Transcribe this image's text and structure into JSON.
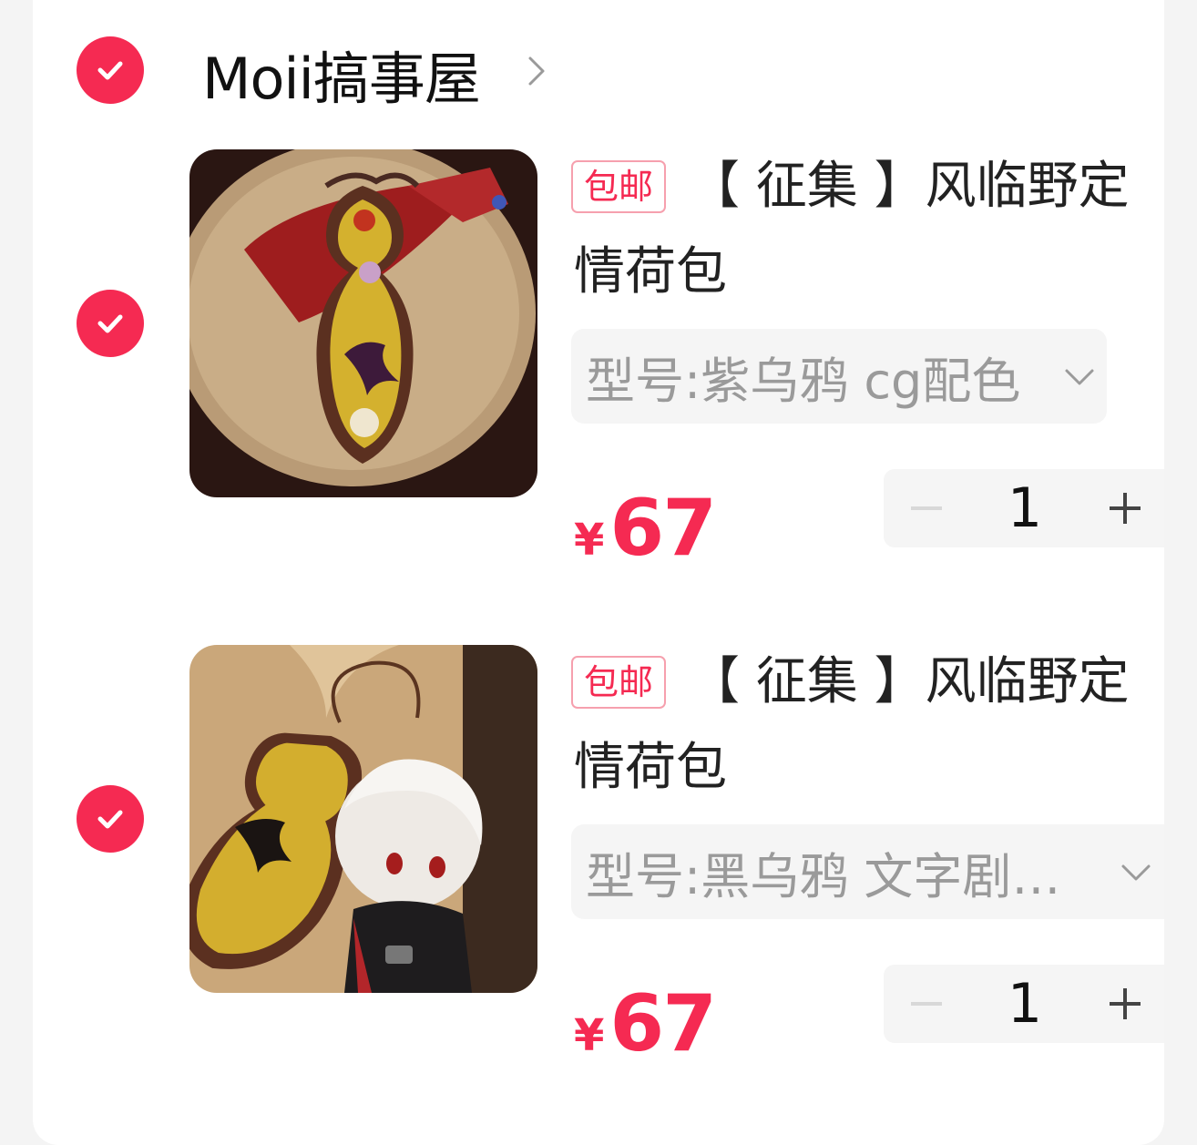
{
  "shop": {
    "name": "Moii搞事屋"
  },
  "colors": {
    "accent": "#f52a52",
    "tag_border": "#f6a0ae",
    "muted": "#9a9a9a"
  },
  "items": [
    {
      "tag": "包邮",
      "title": "【 征集 】风临野定情荷包",
      "variant": "型号:紫乌鸦  cg配色",
      "currency": "¥",
      "price": "67",
      "quantity": "1"
    },
    {
      "tag": "包邮",
      "title": "【 征集 】风临野定情荷包",
      "variant": "型号:黑乌鸦 文字剧…",
      "currency": "¥",
      "price": "67",
      "quantity": "1"
    }
  ]
}
